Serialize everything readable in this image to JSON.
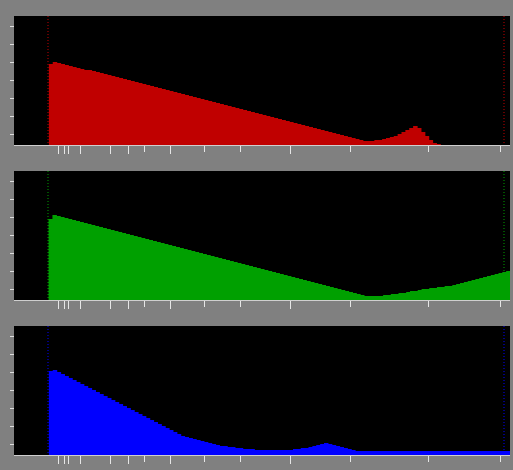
{
  "histograms": [
    {
      "channel": "red",
      "color": "#c00000",
      "levels": [
        0,
        0,
        0,
        0,
        0,
        0,
        0,
        0,
        0,
        0.82,
        0.84,
        0.83,
        0.82,
        0.81,
        0.8,
        0.79,
        0.78,
        0.77,
        0.76,
        0.76,
        0.75,
        0.74,
        0.73,
        0.72,
        0.71,
        0.7,
        0.69,
        0.68,
        0.67,
        0.66,
        0.65,
        0.64,
        0.63,
        0.62,
        0.61,
        0.6,
        0.59,
        0.58,
        0.57,
        0.56,
        0.55,
        0.54,
        0.53,
        0.52,
        0.51,
        0.5,
        0.49,
        0.48,
        0.47,
        0.46,
        0.45,
        0.44,
        0.43,
        0.42,
        0.41,
        0.4,
        0.39,
        0.38,
        0.37,
        0.36,
        0.35,
        0.34,
        0.33,
        0.32,
        0.31,
        0.3,
        0.29,
        0.28,
        0.27,
        0.26,
        0.25,
        0.24,
        0.23,
        0.22,
        0.21,
        0.2,
        0.19,
        0.18,
        0.17,
        0.16,
        0.15,
        0.14,
        0.13,
        0.12,
        0.11,
        0.1,
        0.09,
        0.08,
        0.07,
        0.06,
        0.05,
        0.05,
        0.05,
        0.06,
        0.06,
        0.07,
        0.08,
        0.09,
        0.1,
        0.12,
        0.14,
        0.16,
        0.18,
        0.2,
        0.18,
        0.14,
        0.1,
        0.06,
        0.03,
        0.02,
        0.01,
        0.01,
        0.01,
        0.01,
        0,
        0,
        0,
        0,
        0,
        0,
        0,
        0,
        0,
        0,
        0,
        0,
        0,
        0.01
      ]
    },
    {
      "channel": "green",
      "color": "#00a000",
      "levels": [
        0,
        0,
        0,
        0,
        0,
        0,
        0,
        0,
        0,
        0.82,
        0.86,
        0.85,
        0.84,
        0.83,
        0.82,
        0.81,
        0.8,
        0.79,
        0.78,
        0.77,
        0.76,
        0.75,
        0.74,
        0.73,
        0.72,
        0.71,
        0.7,
        0.69,
        0.68,
        0.67,
        0.66,
        0.65,
        0.64,
        0.63,
        0.62,
        0.61,
        0.6,
        0.59,
        0.58,
        0.57,
        0.56,
        0.55,
        0.54,
        0.53,
        0.52,
        0.51,
        0.5,
        0.49,
        0.48,
        0.47,
        0.46,
        0.45,
        0.44,
        0.43,
        0.42,
        0.41,
        0.4,
        0.39,
        0.38,
        0.37,
        0.36,
        0.35,
        0.34,
        0.33,
        0.32,
        0.31,
        0.3,
        0.29,
        0.28,
        0.27,
        0.26,
        0.25,
        0.24,
        0.23,
        0.22,
        0.21,
        0.2,
        0.19,
        0.18,
        0.17,
        0.16,
        0.15,
        0.14,
        0.13,
        0.12,
        0.11,
        0.1,
        0.09,
        0.08,
        0.07,
        0.06,
        0.05,
        0.05,
        0.05,
        0.05,
        0.05,
        0.06,
        0.06,
        0.07,
        0.07,
        0.08,
        0.08,
        0.09,
        0.1,
        0.1,
        0.11,
        0.12,
        0.12,
        0.13,
        0.13,
        0.14,
        0.14,
        0.15,
        0.15,
        0.16,
        0.17,
        0.18,
        0.19,
        0.2,
        0.21,
        0.22,
        0.23,
        0.24,
        0.25,
        0.26,
        0.27,
        0.28,
        0.29,
        0.3
      ]
    },
    {
      "channel": "blue",
      "color": "#0000ff",
      "levels": [
        0,
        0,
        0,
        0,
        0,
        0,
        0,
        0,
        0,
        0.85,
        0.86,
        0.84,
        0.82,
        0.8,
        0.78,
        0.76,
        0.74,
        0.72,
        0.7,
        0.68,
        0.66,
        0.64,
        0.62,
        0.6,
        0.58,
        0.56,
        0.54,
        0.52,
        0.5,
        0.48,
        0.46,
        0.44,
        0.42,
        0.4,
        0.38,
        0.36,
        0.34,
        0.32,
        0.3,
        0.28,
        0.26,
        0.24,
        0.22,
        0.2,
        0.19,
        0.18,
        0.17,
        0.16,
        0.15,
        0.14,
        0.13,
        0.12,
        0.11,
        0.1,
        0.1,
        0.09,
        0.09,
        0.08,
        0.08,
        0.07,
        0.07,
        0.07,
        0.06,
        0.06,
        0.06,
        0.06,
        0.06,
        0.06,
        0.06,
        0.06,
        0.06,
        0.06,
        0.07,
        0.07,
        0.08,
        0.08,
        0.09,
        0.1,
        0.11,
        0.12,
        0.13,
        0.12,
        0.11,
        0.1,
        0.09,
        0.08,
        0.07,
        0.06,
        0.05,
        0.05,
        0.05,
        0.05,
        0.05,
        0.05,
        0.05,
        0.05,
        0.05,
        0.05,
        0.05,
        0.05,
        0.05,
        0.05,
        0.05,
        0.05,
        0.05,
        0.05,
        0.05,
        0.05,
        0.05,
        0.05,
        0.05,
        0.05,
        0.05,
        0.05,
        0.05,
        0.05,
        0.05,
        0.05,
        0.05,
        0.05,
        0.05,
        0.05,
        0.05,
        0.05,
        0.05,
        0.05,
        0.05,
        0.05
      ]
    }
  ]
}
